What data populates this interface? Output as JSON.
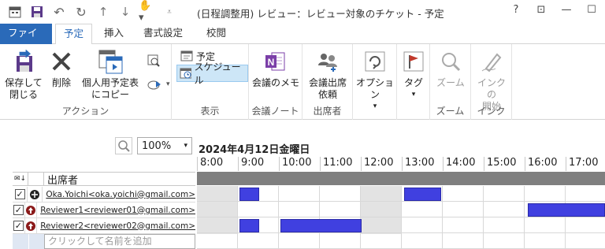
{
  "title": "(日程調整用) レビュー：レビュー対象のチケット - 予定",
  "window_buttons": [
    "?",
    "⊡",
    "—",
    "☐"
  ],
  "tabs": {
    "file": "ファイル",
    "items": [
      "予定",
      "挿入",
      "書式設定",
      "校閲"
    ]
  },
  "ribbon": {
    "action": {
      "label": "アクション",
      "save_close": [
        "保存して",
        "閉じる"
      ],
      "delete": "削除",
      "copy_personal": [
        "個人用予定表",
        "にコピー"
      ]
    },
    "display": {
      "label": "表示",
      "appointment": "予定",
      "schedule": "スケジュール"
    },
    "meeting_notes": {
      "label": "会議ノート",
      "button": "会議のメモ"
    },
    "attendees": {
      "label": "出席者",
      "button": [
        "会議出席",
        "依頼"
      ]
    },
    "options": {
      "button": "オプション"
    },
    "tags": {
      "button": "タグ"
    },
    "zoom": {
      "label": "ズーム",
      "button": "ズーム"
    },
    "ink": {
      "label": "インク",
      "button": [
        "インクの",
        "開始"
      ]
    }
  },
  "schedule": {
    "zoom": "100%",
    "date": "2024年4月12日金曜日",
    "hours": [
      "8:00",
      "9:00",
      "10:00",
      "11:00",
      "12:00",
      "13:00",
      "14:00",
      "15:00",
      "16:00",
      "17:00"
    ],
    "attendees_header": "出席者",
    "attendees": [
      {
        "name": "Oka.Yoichi<oka.yoichi@gmail.com>",
        "role": "organizer"
      },
      {
        "name": "Reviewer1<reviewer01@gmail.com>",
        "role": "required"
      },
      {
        "name": "Reviewer2<reviewer02@gmail.com>",
        "role": "required"
      }
    ],
    "add_placeholder": "クリックして名前を追加"
  },
  "colors": {
    "busy": "#4040e0",
    "accent": "#2a6ab9",
    "file_tab": "#2a6ab9"
  }
}
